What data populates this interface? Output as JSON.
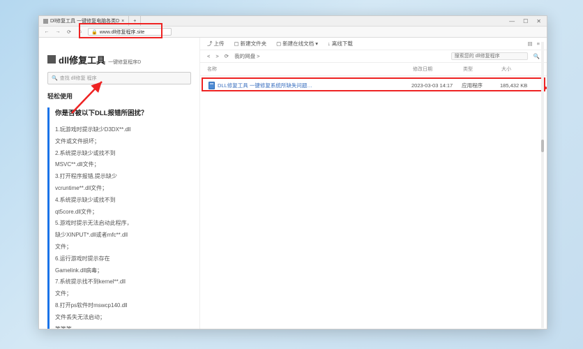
{
  "browser": {
    "tab_title": "Dll修复工具 一键修复电脑各类D",
    "close_x": "×",
    "new_tab": "+",
    "min": "—",
    "max": "☐",
    "close": "✕",
    "back": "←",
    "forward": "→",
    "reload": "⟳",
    "home": "⌂",
    "lock": "🔒",
    "url": "www.dll修复程序.site"
  },
  "left": {
    "title_big": "dll修复工具",
    "title_sub": "一键修复程序D",
    "search_placeholder": "查找 dll修复 程序",
    "search_icon": "🔍",
    "section_head": "轻松使用",
    "question_title": "你是否被以下DLL报错所困扰？",
    "items": [
      "1.玩游戏时提示缺少D3DX**.dll",
      "文件或文件损坏；",
      "2.系统提示缺少或找不到",
      "MSVC**.dll文件；",
      "3.打开程序报错,提示缺少",
      "vcruntime**.dll文件；",
      "4.系统提示缺少或找不到",
      "qt5core.dll文件；",
      "5.游戏时提示无法启动此程序，",
      "缺少XINPUT*.dll或者mfc**.dll",
      "文件；",
      "6.运行游戏时提示存在",
      "Gamelink.dll病毒；",
      "7.系统提示找不到kernel**.dll",
      "文件；",
      "8.打开ps软件时mswcp140.dll",
      "文件丢失无法启动；",
      "等等等……"
    ]
  },
  "right": {
    "toolbar": {
      "upload": "上传",
      "new_folder": "新建文件夹",
      "new_online": "新建在线文档",
      "offline": "离线下载",
      "up_icon": "⤴",
      "folder_icon": "▢",
      "doc_icon": "▢",
      "dl_icon": "↓",
      "view1": "▤",
      "view2": "≡"
    },
    "path": {
      "back": "<",
      "fwd": ">",
      "reload": "⟳",
      "location": "我的网盘 >",
      "search_placeholder": "搜索您的 dll修复程序",
      "search_icon": "🔍"
    },
    "cols": {
      "name": "名称",
      "mtime": "修改日期",
      "type": "类型",
      "size": "大小"
    },
    "file": {
      "name": "DLL修复工具 一键修复系统所缺失问题…",
      "mtime": "2023-03-03 14:17",
      "type": "应用程序",
      "size": "185,432 KB"
    }
  }
}
